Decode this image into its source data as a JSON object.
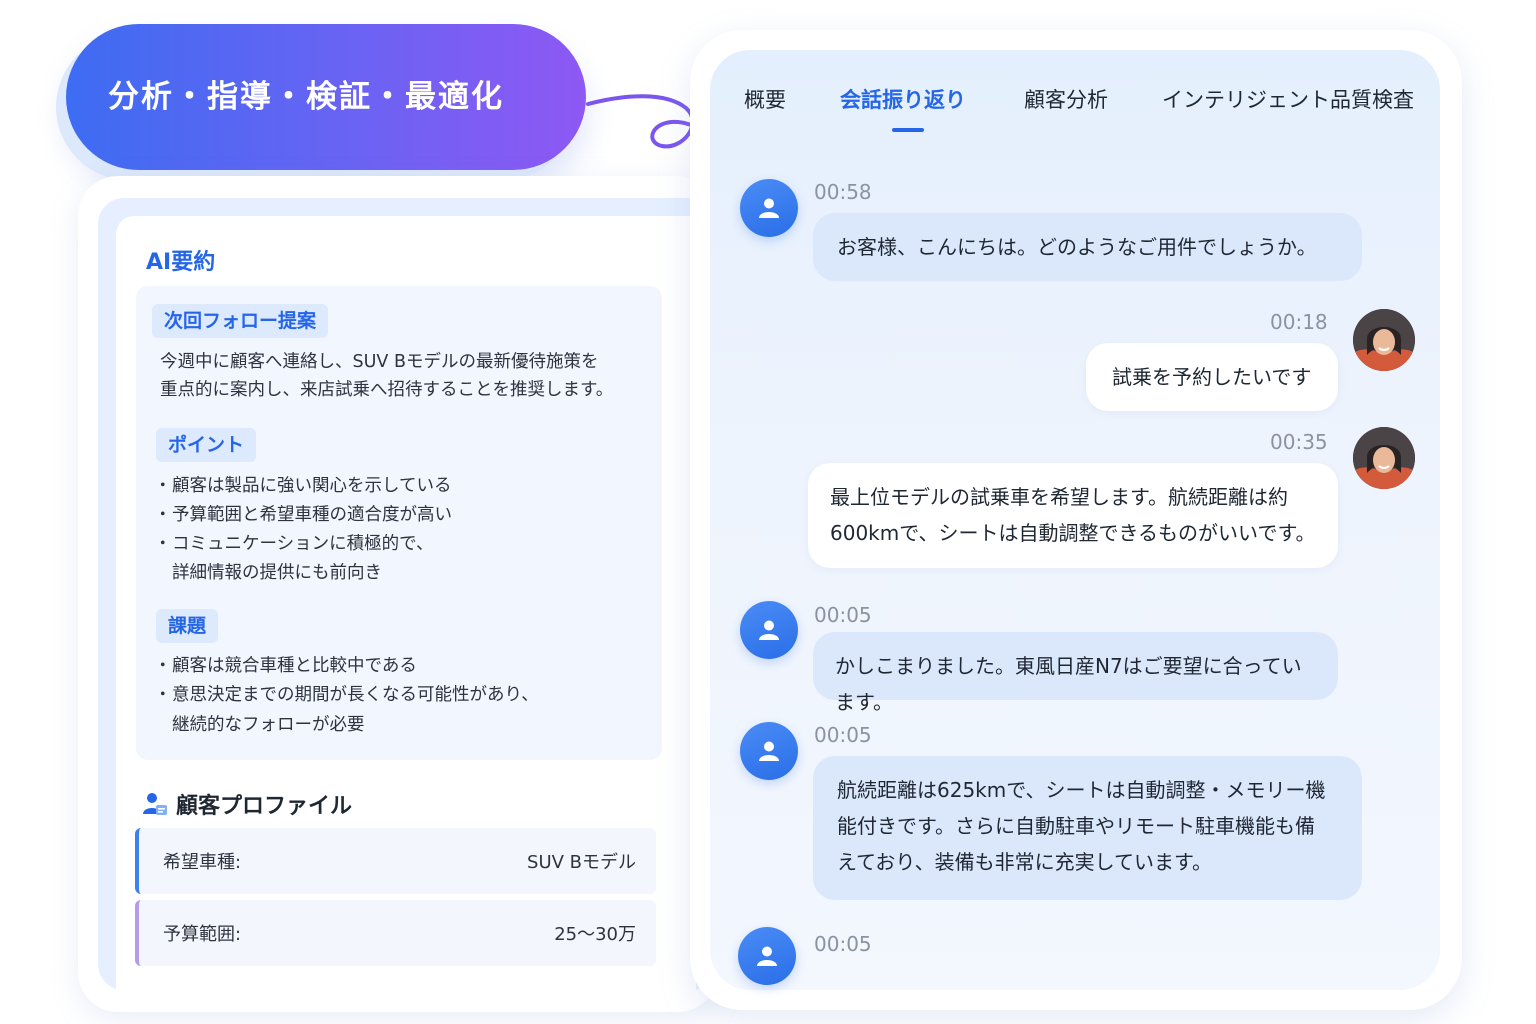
{
  "banner": {
    "title": "分析・指導・検証・最適化"
  },
  "tabs": [
    {
      "label": "概要"
    },
    {
      "label": "会話振り返り",
      "active": true
    },
    {
      "label": "顧客分析"
    },
    {
      "label": "インテリジェント品質検査"
    }
  ],
  "summary": {
    "title": "AI要約",
    "follow_up": {
      "tag": "次回フォロー提案",
      "lines": [
        "今週中に顧客へ連絡し、SUV Bモデルの最新優待施策を",
        "重点的に案内し、来店試乗へ招待することを推奨します。"
      ]
    },
    "points": {
      "tag": "ポイント",
      "bullets": [
        "顧客は製品に強い関心を示している",
        "予算範囲と希望車種の適合度が高い",
        "コミュニケーションに積極的で、",
        "詳細情報の提供にも前向き"
      ]
    },
    "issues": {
      "tag": "課題",
      "bullets": [
        "顧客は競合車種と比較中である",
        "意思決定までの期間が長くなる可能性があり、",
        "継続的なフォローが必要"
      ]
    },
    "bullet_char": "・"
  },
  "profile": {
    "title": "顧客プロファイル",
    "rows": [
      {
        "label": "希望車種:",
        "value": "SUV Bモデル"
      },
      {
        "label": "予算範囲:",
        "value": "25〜30万"
      }
    ]
  },
  "messages": [
    {
      "role": "agent",
      "time": "00:58",
      "lines": [
        "お客様、こんにちは。どのようなご用件でしょうか。"
      ]
    },
    {
      "role": "customer",
      "time": "00:18",
      "lines": [
        "試乗を予約したいです"
      ]
    },
    {
      "role": "customer",
      "time": "00:35",
      "lines": [
        "最上位モデルの試乗車を希望します。航続距離は約",
        "600kmで、シートは自動調整できるものがいいです。"
      ]
    },
    {
      "role": "agent",
      "time": "00:05",
      "lines": [
        "かしこまりました。東風日産N7はご要望に合っています。"
      ]
    },
    {
      "role": "agent",
      "time": "00:05",
      "lines": [
        "航続距離は625kmで、シートは自動調整・メモリー機",
        "能付きです。さらに自動駐車やリモート駐車機能も備",
        "えており、装備も非常に充実しています。"
      ]
    },
    {
      "role": "agent",
      "time": "00:05",
      "lines": []
    }
  ],
  "colors": {
    "accent": "#2566e8",
    "banner_start": "#3d6cf2",
    "banner_end": "#8e58f4",
    "agent_bubble": "#dbe8fc"
  },
  "icons": {
    "agent_avatar": "user-icon",
    "profile": "user-profile-icon"
  }
}
